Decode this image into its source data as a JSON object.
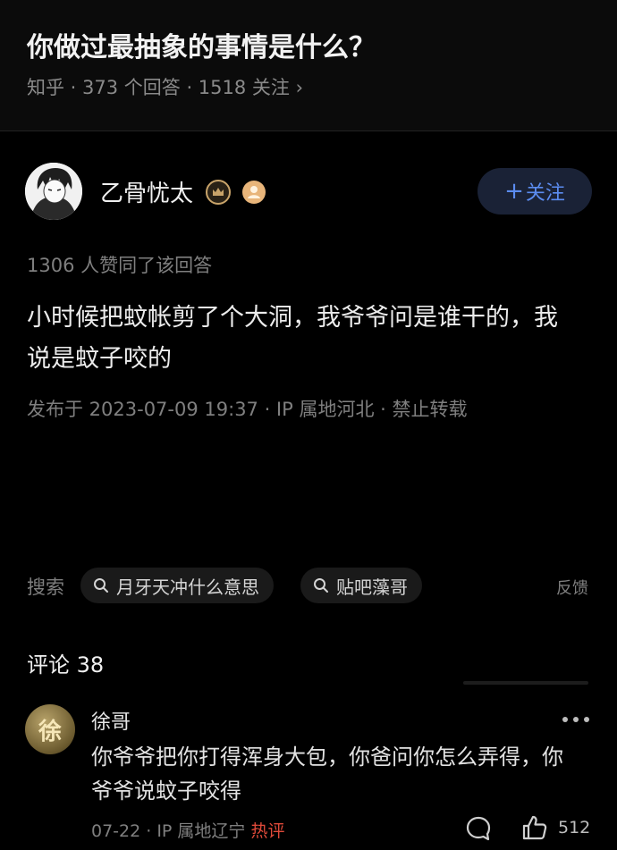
{
  "question": {
    "title": "你做过最抽象的事情是什么？",
    "meta": "知乎 · 373 个回答 · 1518 关注 ›"
  },
  "author": {
    "name": "乙骨忧太",
    "follow_label": "关注",
    "follow_plus": "+"
  },
  "answer": {
    "agree_count": "1306 人赞同了该回答",
    "body": "小时候把蚊帐剪了个大洞，我爷爷问是谁干的，我说是蚊子咬的",
    "publish_info": "发布于 2023-07-09 19:37 · IP 属地河北 · 禁止转载"
  },
  "search": {
    "label": "搜索",
    "chips": [
      "月牙天冲什么意思",
      "贴吧藻哥"
    ],
    "feedback": "反馈"
  },
  "comments": {
    "title": "评论 38",
    "items": [
      {
        "name": "徐哥",
        "avatar_char": "徐",
        "text": "你爷爷把你打得浑身大包，你爸问你怎么弄得，你爷爷说蚊子咬得",
        "date_ip": "07-22 · IP 属地辽宁",
        "hot_tag": "热评",
        "likes": "512"
      }
    ]
  },
  "colors": {
    "background": "#000000",
    "accent_blue": "#5b8cf0",
    "hot_red": "#e04a3a",
    "badge_gold": "#c9a46a"
  }
}
